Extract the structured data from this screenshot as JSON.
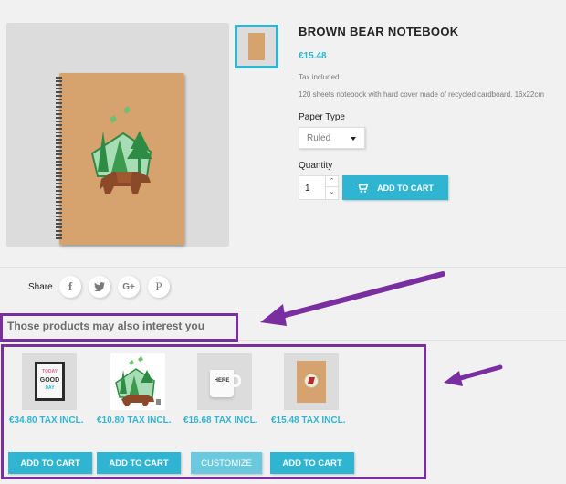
{
  "product": {
    "title": "BROWN BEAR NOTEBOOK",
    "price": "€15.48",
    "tax_label": "Tax included",
    "description": "120 sheets notebook with hard cover made of recycled cardboard. 16x22cm",
    "paper_type_label": "Paper Type",
    "paper_type_value": "Ruled",
    "quantity_label": "Quantity",
    "quantity_value": "1",
    "add_to_cart_label": "ADD TO CART"
  },
  "share": {
    "label": "Share",
    "networks": [
      {
        "name": "facebook",
        "glyph": "f"
      },
      {
        "name": "twitter",
        "glyph": "t"
      },
      {
        "name": "google-plus",
        "glyph": "G+"
      },
      {
        "name": "pinterest",
        "glyph": "P"
      }
    ]
  },
  "related": {
    "title": "Those products may also interest you",
    "products": [
      {
        "image": "framed-poster",
        "price": "€34.80 TAX INCL.",
        "button": "ADD TO CART"
      },
      {
        "image": "bear-sticker",
        "price": "€10.80 TAX INCL.",
        "button": "ADD TO CART"
      },
      {
        "image": "mug",
        "price": "€16.68 TAX INCL.",
        "button": "CUSTOMIZE"
      },
      {
        "image": "notebook-hummingbird",
        "price": "€15.48 TAX INCL.",
        "button": "ADD TO CART"
      }
    ]
  },
  "poster_text": {
    "line1": "TODAY",
    "line2": "GOOD",
    "line3": "DAY"
  },
  "mug_text": "HERE",
  "colors": {
    "accent": "#2fb5d2",
    "annotation": "#7a2fa0"
  }
}
